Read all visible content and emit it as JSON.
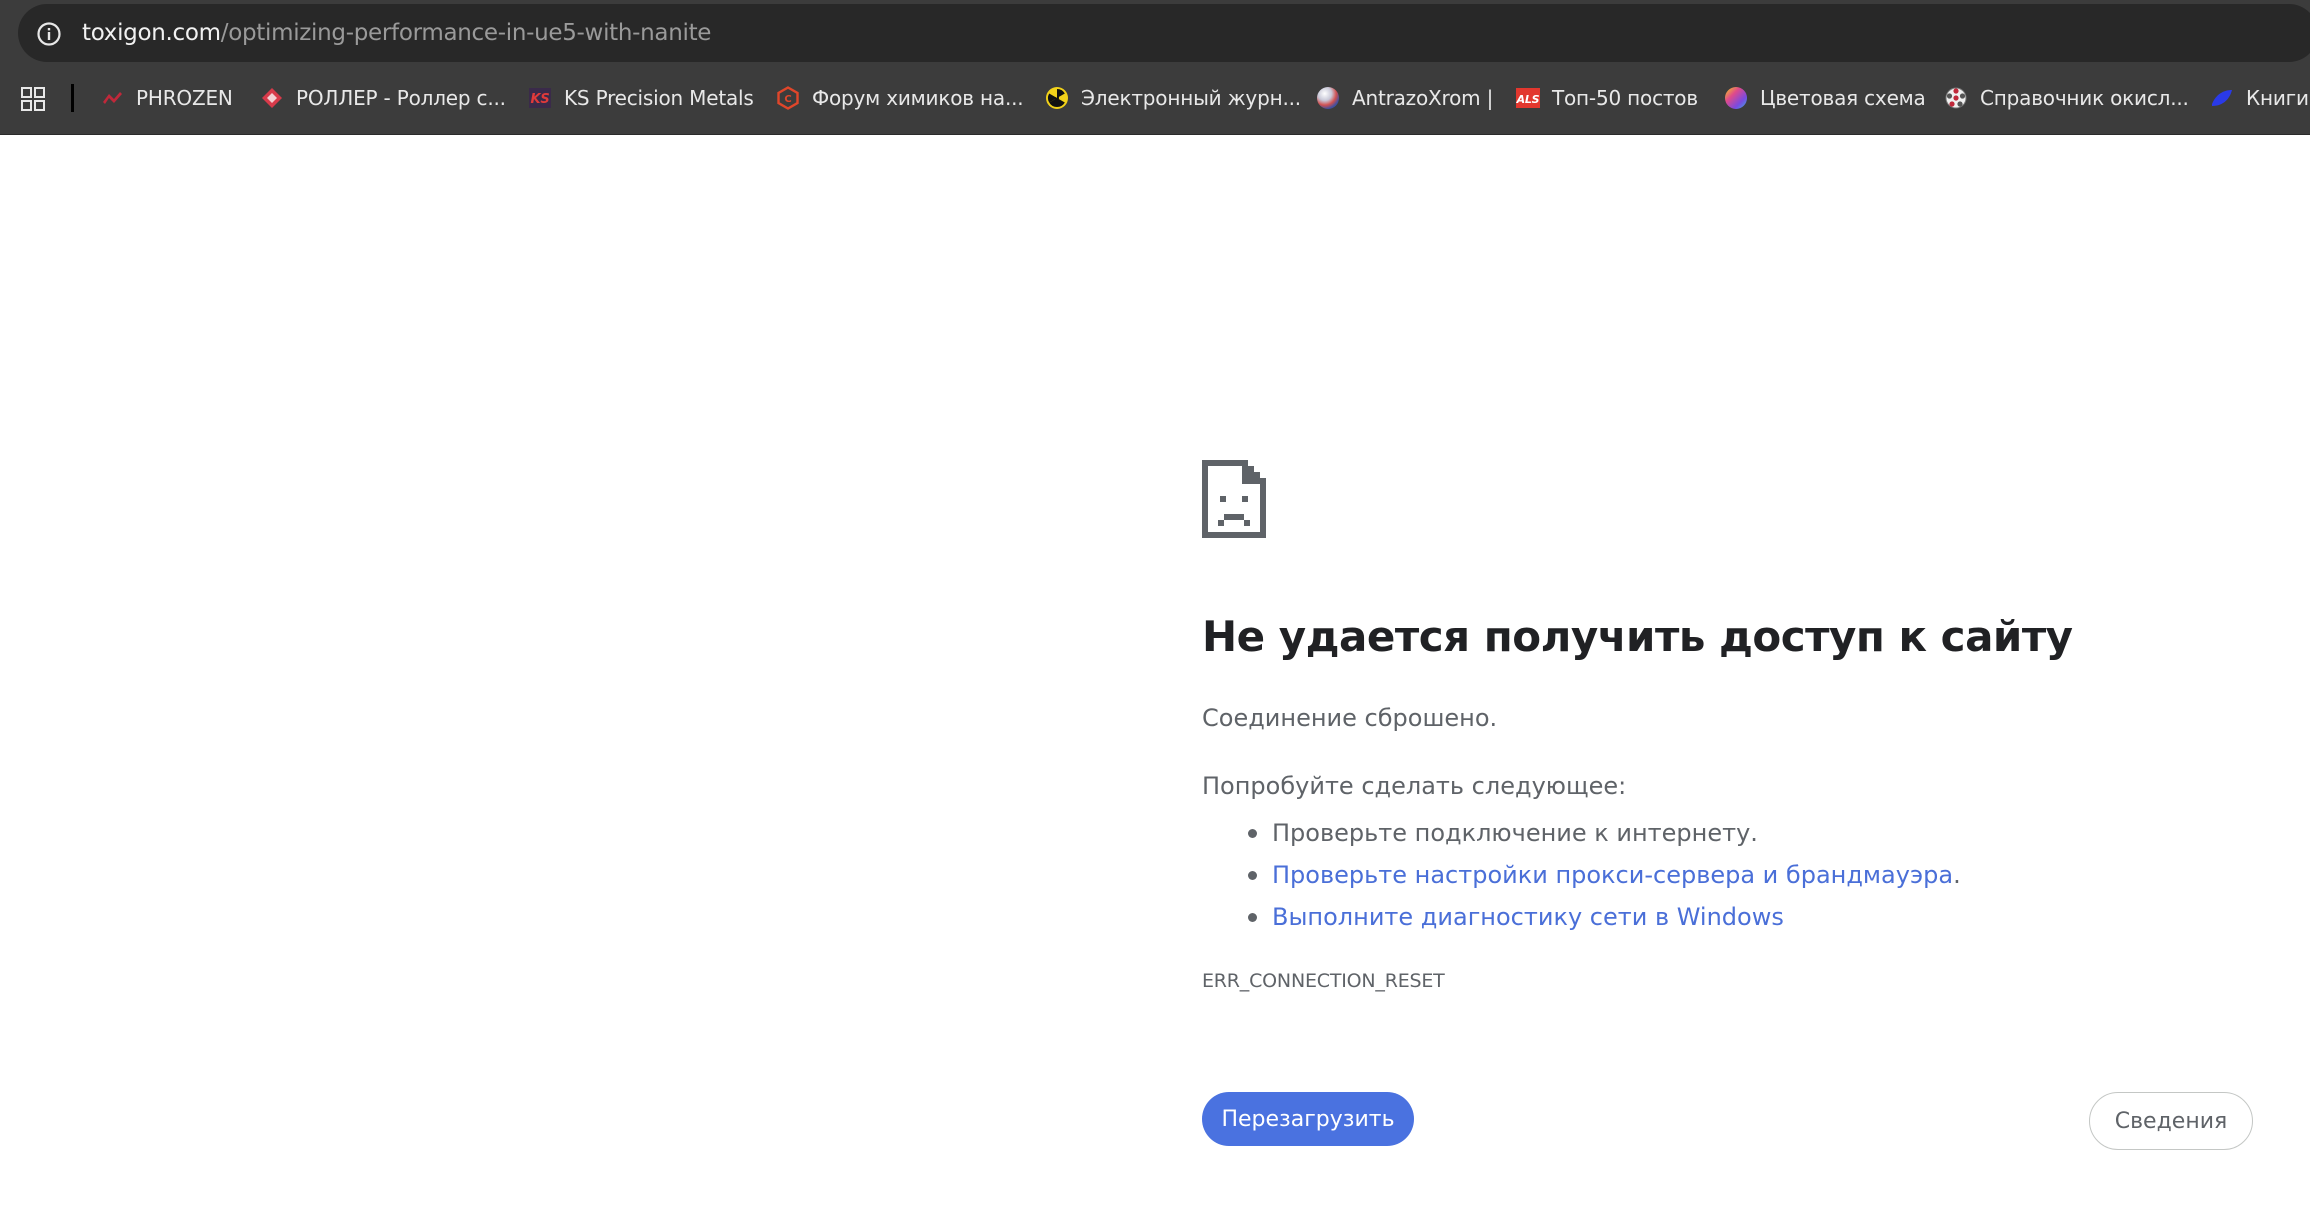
{
  "address_bar": {
    "domain": "toxigon.com",
    "path": "/optimizing-performance-in-ue5-with-nanite"
  },
  "bookmarks": [
    {
      "label": "PHROZEN",
      "icon": "phrozen-icon",
      "color": "#c0283a"
    },
    {
      "label": "РОЛЛЕР - Роллер с...",
      "icon": "roller-icon",
      "color": "#d83a4a"
    },
    {
      "label": "KS Precision Metals",
      "icon": "ks-icon",
      "color": "#c0283a"
    },
    {
      "label": "Форум химиков на...",
      "icon": "hexagon-icon",
      "color": "#e0462a"
    },
    {
      "label": "Электронный журн...",
      "icon": "radiation-icon",
      "color": "#f2d21a"
    },
    {
      "label": "AntrazoXrom |",
      "icon": "sphere-icon",
      "color": "#d8d8d8"
    },
    {
      "label": "Топ-50 постов",
      "icon": "als-icon",
      "color": "#e2372e"
    },
    {
      "label": "Цветовая схема",
      "icon": "color-wheel-icon",
      "color": "#a04ad8"
    },
    {
      "label": "Справочник окисл...",
      "icon": "molecule-icon",
      "color": "#d8d8d8"
    },
    {
      "label": "Книги",
      "icon": "book-icon",
      "color": "#2a3ae8"
    }
  ],
  "error": {
    "title": "Не удается получить доступ к сайту",
    "subtitle": "Соединение сброшено.",
    "try_label": "Попробуйте сделать следующее:",
    "suggestions": [
      {
        "text": "Проверьте подключение к интернету.",
        "link": false
      },
      {
        "text": "Проверьте настройки прокси-сервера и брандмауэра",
        "suffix": ".",
        "link": true
      },
      {
        "text": "Выполните диагностику сети в Windows",
        "link": true
      }
    ],
    "code": "ERR_CONNECTION_RESET"
  },
  "buttons": {
    "reload": "Перезагрузить",
    "details": "Сведения"
  },
  "colors": {
    "accent": "#4a72e0",
    "link": "#4a6fd8",
    "title": "#202124",
    "text": "#5f6368"
  }
}
